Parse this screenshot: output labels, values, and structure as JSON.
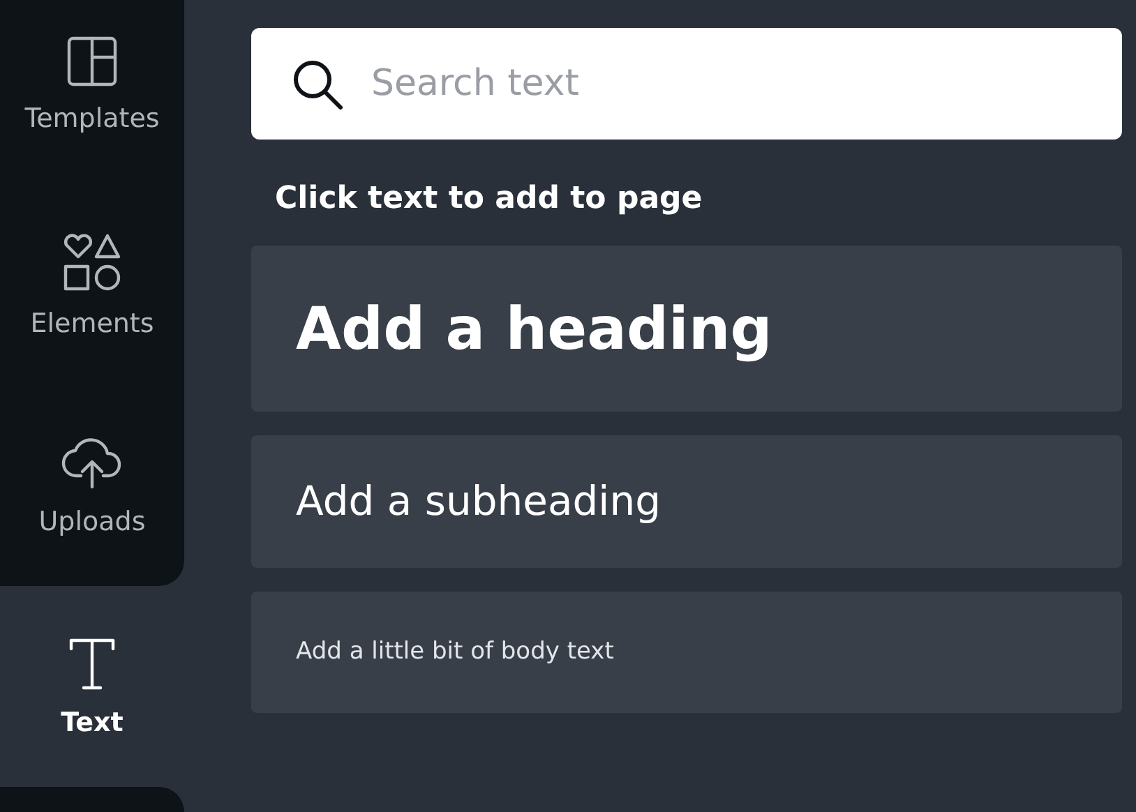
{
  "sidebar": {
    "items": [
      {
        "kind": "templates",
        "label": "Templates",
        "selected": false
      },
      {
        "kind": "elements",
        "label": "Elements",
        "selected": false
      },
      {
        "kind": "uploads",
        "label": "Uploads",
        "selected": false
      },
      {
        "kind": "text",
        "label": "Text",
        "selected": true
      }
    ]
  },
  "search": {
    "placeholder": "Search text"
  },
  "section_title": "Click text to add to page",
  "text_options": [
    {
      "kind": "heading",
      "label": "Add a heading"
    },
    {
      "kind": "subheading",
      "label": "Add a subheading"
    },
    {
      "kind": "body",
      "label": "Add a little bit of body text"
    }
  ]
}
